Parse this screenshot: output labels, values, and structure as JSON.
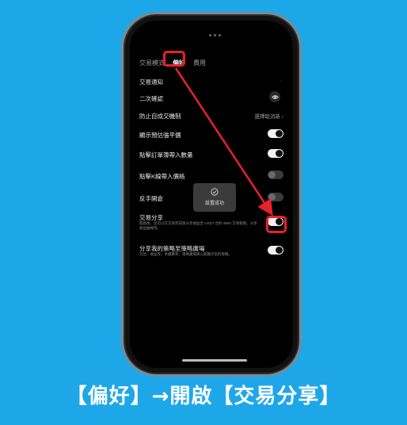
{
  "tabs": [
    "交易模式",
    "偏好",
    "費用"
  ],
  "active_tab": "偏好",
  "settings": [
    {
      "label": "交易通知",
      "right": ""
    },
    {
      "label": "二次確認",
      "right": ""
    },
    {
      "label": "防止自成交機制",
      "right": "選擇取消新 ›"
    },
    {
      "label": "顯示預估強平價",
      "toggle": "on"
    },
    {
      "label": "點擊訂單簿帶入數量",
      "toggle": "on"
    },
    {
      "label": "點擊K線帶入價格",
      "toggle": "off"
    },
    {
      "label": "反手開倉",
      "toggle": "off"
    },
    {
      "label": "交易分享",
      "toggle": "on",
      "desc": "開啟後，您可以在交易完成後分享收益至 USDT 合約 /BBS 交易動態，分享收益曲線等。"
    },
    {
      "label": "分享我的策略至策略廣場",
      "toggle": "on",
      "desc": "包括：收益等、手續費率，策略廣場將公開顯示您的策略。"
    }
  ],
  "toast": "設置成功",
  "caption": "【偏好】→開啟【交易分享】",
  "colors": {
    "background": "#1ea7e8",
    "highlight": "#e8212b"
  }
}
